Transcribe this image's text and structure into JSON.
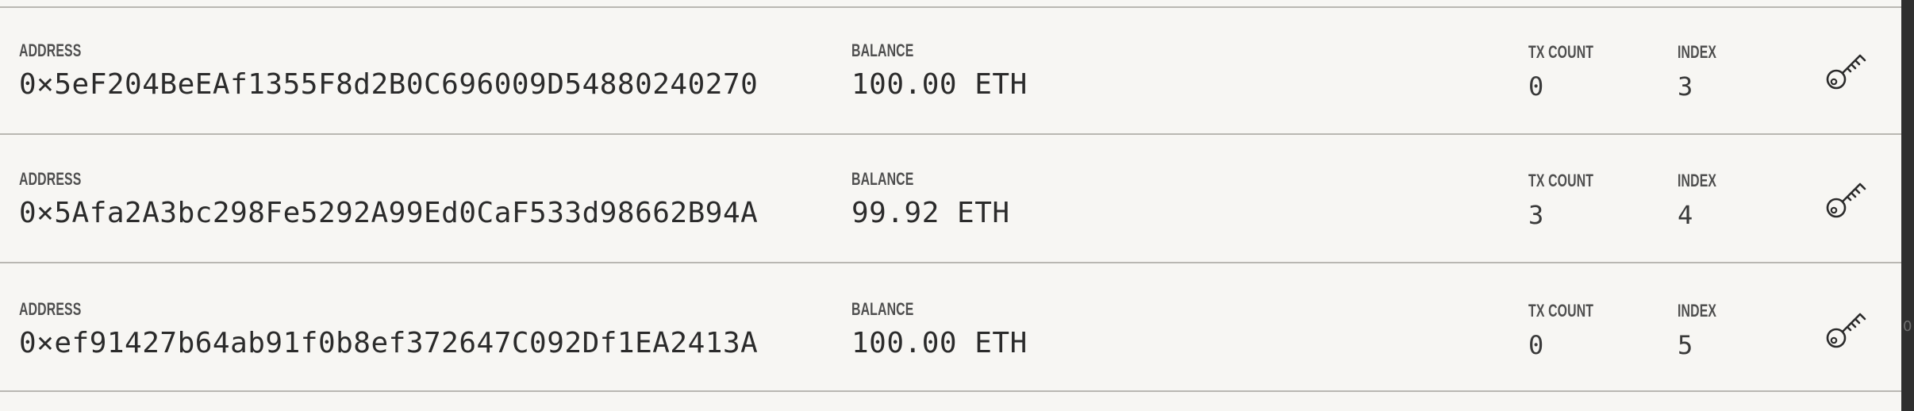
{
  "accounts": [
    {
      "address_label": "ADDRESS",
      "address": "0×5eF204BeEAf1355F8d2B0C696009D54880240270",
      "balance_label": "BALANCE",
      "balance": "100.00  ETH",
      "tx_count_label": "TX COUNT",
      "tx_count": "0",
      "index_label": "INDEX",
      "index": "3",
      "key_icon": "key-icon"
    },
    {
      "address_label": "ADDRESS",
      "address": "0×5Afa2A3bc298Fe5292A99Ed0CaF533d98662B94A",
      "balance_label": "BALANCE",
      "balance": "99.92  ETH",
      "tx_count_label": "TX COUNT",
      "tx_count": "3",
      "index_label": "INDEX",
      "index": "4",
      "key_icon": "key-icon"
    },
    {
      "address_label": "ADDRESS",
      "address": "0×ef91427b64ab91f0b8ef372647C092Df1EA2413A",
      "balance_label": "BALANCE",
      "balance": "100.00  ETH",
      "tx_count_label": "TX COUNT",
      "tx_count": "0",
      "index_label": "INDEX",
      "index": "5",
      "key_icon": "key-icon"
    }
  ],
  "scrollbar": {
    "glyph": "0"
  },
  "colors": {
    "background": "#f7f6f3",
    "divider": "#b9b7b2",
    "label_text": "#4f4f4f",
    "value_text": "#2b2b2b",
    "scrollbar": "#2f2f2f"
  }
}
